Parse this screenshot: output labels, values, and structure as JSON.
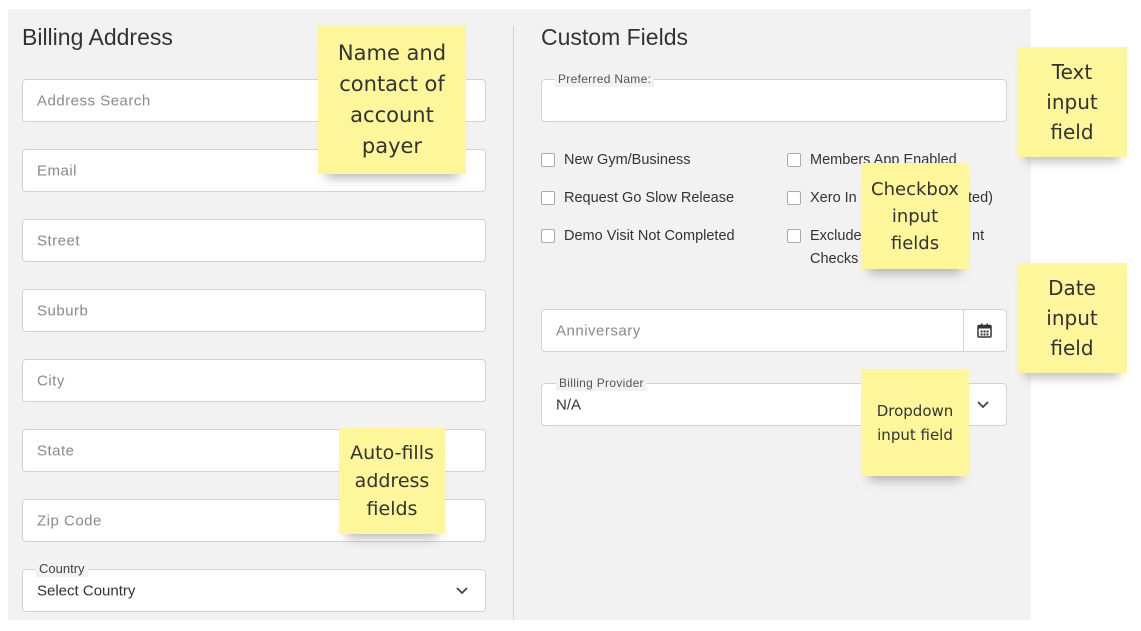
{
  "billing": {
    "title": "Billing Address",
    "address_search_placeholder": "Address Search",
    "email_placeholder": "Email",
    "street_placeholder": "Street",
    "suburb_placeholder": "Suburb",
    "city_placeholder": "City",
    "state_placeholder": "State",
    "zip_placeholder": "Zip Code",
    "country_label": "Country",
    "country_value": "Select Country"
  },
  "custom": {
    "title": "Custom Fields",
    "preferred_name_label": "Preferred Name:",
    "preferred_name_value": "",
    "checkboxes": [
      "New Gym/Business",
      "Request Go Slow Release",
      "Demo Visit Not Completed",
      "Members App Enabled",
      "Xero In",
      "ted)",
      "Exclude",
      "nt",
      "Checks"
    ],
    "anniversary_placeholder": "Anniversary",
    "billing_provider_label": "Billing Provider",
    "billing_provider_value": "N/A"
  },
  "notes": {
    "name_contact": "Name and\ncontact of\naccount\npayer",
    "autofill": "Auto-fills\naddress\nfields",
    "text_input": "Text\ninput\nfield",
    "checkbox": "Checkbox\ninput\nfields",
    "date_input": "Date\ninput\nfield",
    "dropdown": "Dropdown\ninput field"
  },
  "colors": {
    "panel_bg": "#f2f2f2",
    "sticky_note": "#fdf69a",
    "field_border": "#d3d3d3"
  },
  "icons": {
    "calendar": "calendar-icon",
    "chevron": "chevron-down-icon"
  }
}
